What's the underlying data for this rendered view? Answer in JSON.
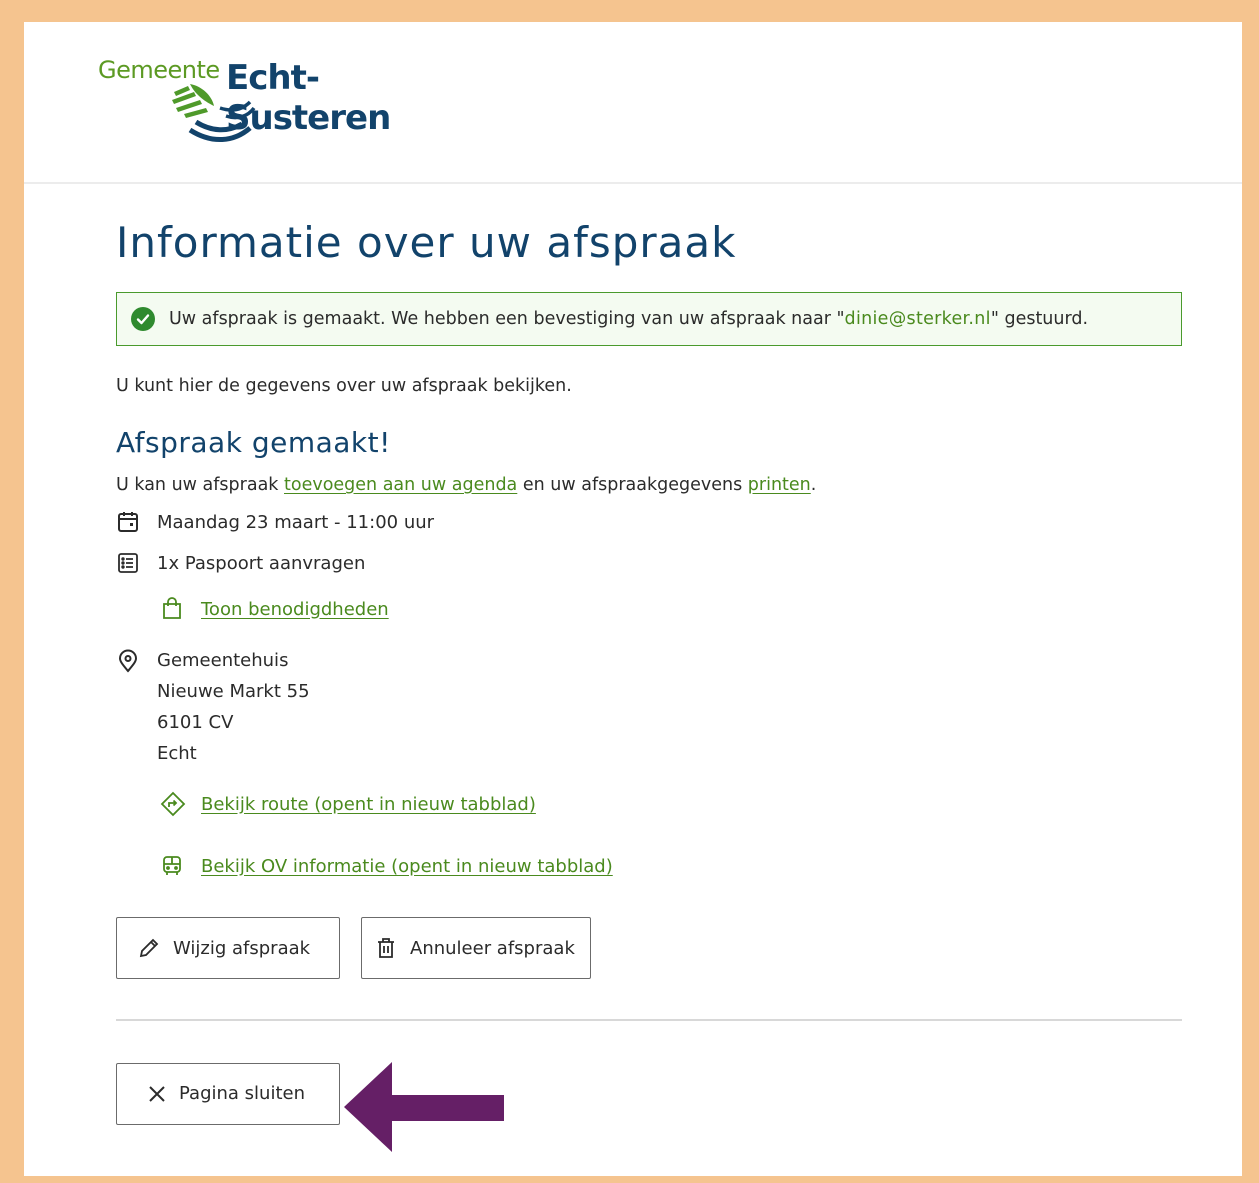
{
  "header": {
    "logo_prefix": "Gemeente",
    "logo_name": "Echt-Susteren"
  },
  "page": {
    "title": "Informatie over uw afspraak"
  },
  "alert": {
    "text_before": "Uw afspraak is gemaakt. We hebben een bevestiging van uw afspraak naar \"",
    "email": "dinie@sterker.nl",
    "text_after": "\" gestuurd."
  },
  "intro": "U kunt hier de gegevens over uw afspraak bekijken.",
  "confirmation": {
    "title": "Afspraak gemaakt!",
    "text_1": "U kan uw afspraak ",
    "agenda_link": "toevoegen aan uw agenda",
    "text_2": " en uw afspraakgegevens ",
    "print_link": "printen",
    "text_3": "."
  },
  "appointment": {
    "date_time": "Maandag 23 maart - 11:00 uur",
    "product": "1x Paspoort aanvragen",
    "requirements_link": "Toon benodigdheden",
    "location": {
      "name": "Gemeentehuis",
      "street": "Nieuwe Markt 55",
      "postal_code": "6101 CV",
      "city": "Echt"
    },
    "route_link": "Bekijk route (opent in nieuw tabblad)",
    "ov_link": "Bekijk OV informatie (opent in nieuw tabblad)"
  },
  "actions": {
    "edit_label": "Wijzig afspraak",
    "cancel_label": "Annuleer afspraak",
    "close_label": "Pagina sluiten"
  },
  "icons": {
    "alert": "check-circle-icon",
    "date": "calendar-icon",
    "product": "list-icon",
    "requirements": "shopping-bag-icon",
    "location": "map-pin-icon",
    "route": "route-sign-icon",
    "ov": "bus-icon",
    "edit": "pencil-icon",
    "cancel": "trash-icon",
    "close": "close-icon",
    "annotation": "arrow-left-icon"
  },
  "colors": {
    "frame": "#f5c48f",
    "heading": "#12436b",
    "link": "#4a8a1e",
    "success": "#2f8a2f",
    "annotation_arrow": "#651f66"
  }
}
